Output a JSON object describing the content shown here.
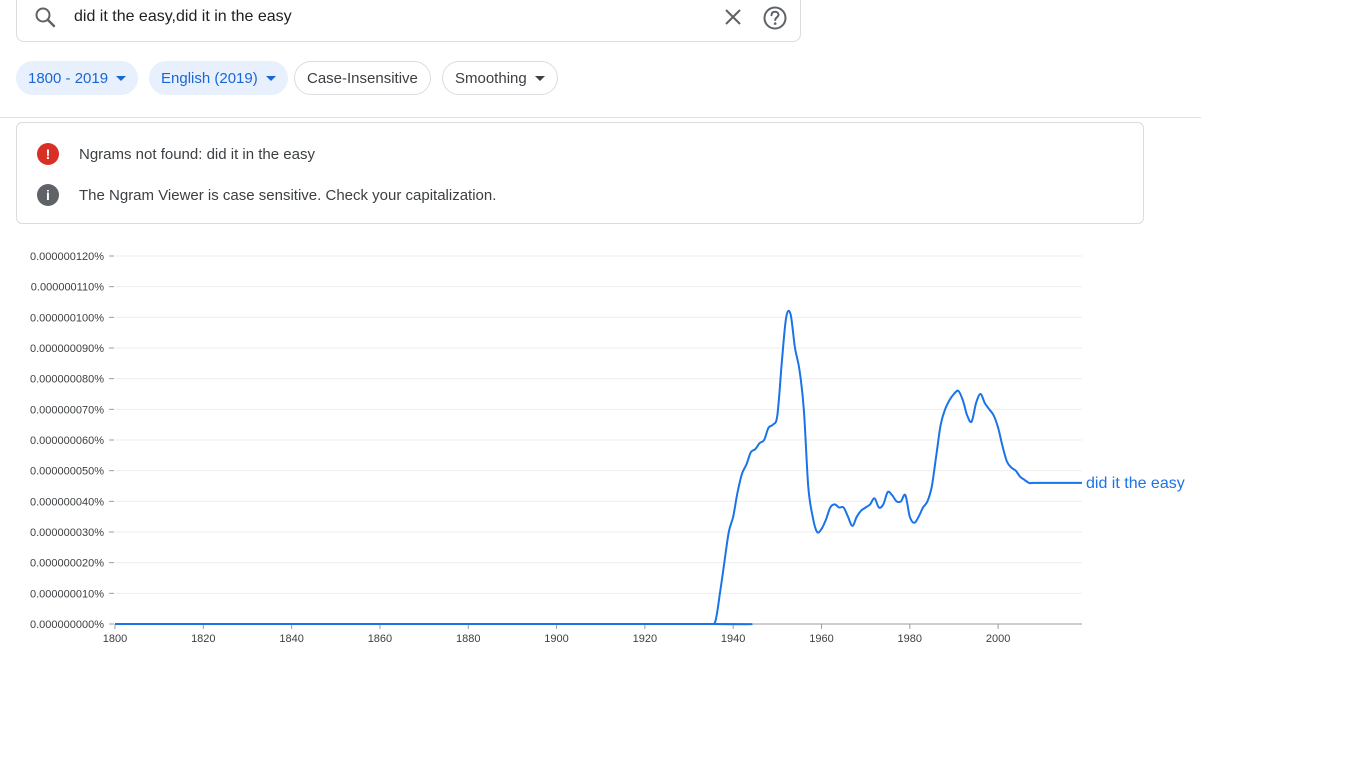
{
  "search": {
    "query": "did it the easy,did it in the easy"
  },
  "filters": {
    "year_range": "1800 - 2019",
    "corpus": "English (2019)",
    "case": "Case-Insensitive",
    "smoothing": "Smoothing"
  },
  "notices": [
    {
      "text": "Ngrams not found: did it in the easy",
      "icon_symbol": "!",
      "color": "#d93025"
    },
    {
      "text": "The Ngram Viewer is case sensitive. Check your capitalization.",
      "icon_symbol": "i",
      "color": "#5f6368"
    }
  ],
  "chart_data": {
    "type": "line",
    "title": "",
    "xlabel": "",
    "ylabel": "",
    "xlim": [
      1800,
      2019
    ],
    "ylim": [
      0,
      1.2e-07
    ],
    "y_tick_labels": [
      "0.000000000%",
      "0.000000010%",
      "0.000000020%",
      "0.000000030%",
      "0.000000040%",
      "0.000000050%",
      "0.000000060%",
      "0.000000070%",
      "0.000000080%",
      "0.000000090%",
      "0.000000100%",
      "0.000000110%",
      "0.000000120%"
    ],
    "x_tick_labels": [
      "1800",
      "1820",
      "1840",
      "1860",
      "1880",
      "1900",
      "1920",
      "1940",
      "1960",
      "1980",
      "2000"
    ],
    "series": [
      {
        "name": "did it the easy",
        "color": "#1a73e8",
        "x": [
          1800,
          1934,
          1935,
          1936,
          1937,
          1938,
          1939,
          1940,
          1941,
          1942,
          1943,
          1944,
          1945,
          1946,
          1947,
          1948,
          1949,
          1950,
          1951,
          1952,
          1953,
          1954,
          1955,
          1956,
          1957,
          1958,
          1959,
          1960,
          1961,
          1962,
          1963,
          1964,
          1965,
          1966,
          1967,
          1968,
          1969,
          1970,
          1971,
          1972,
          1973,
          1974,
          1975,
          1976,
          1977,
          1978,
          1979,
          1980,
          1981,
          1982,
          1983,
          1984,
          1985,
          1986,
          1987,
          1988,
          1989,
          1990,
          1991,
          1992,
          1993,
          1994,
          1995,
          1996,
          1997,
          1998,
          1999,
          2000,
          2001,
          2002,
          2003,
          2004,
          2005,
          2006,
          2007,
          2008,
          2009,
          2010,
          2011,
          2012,
          2013,
          2014,
          2015,
          2016,
          2017,
          2018,
          2019
        ],
        "values": [
          0,
          0,
          0,
          0.1,
          1.0,
          2.0,
          3.0,
          3.5,
          4.3,
          4.9,
          5.2,
          5.6,
          5.7,
          5.9,
          6.0,
          6.4,
          6.5,
          6.8,
          8.5,
          10.0,
          10.1,
          9.0,
          8.3,
          7.0,
          4.5,
          3.5,
          3.0,
          3.1,
          3.4,
          3.8,
          3.9,
          3.8,
          3.8,
          3.5,
          3.2,
          3.5,
          3.7,
          3.8,
          3.9,
          4.1,
          3.8,
          3.9,
          4.3,
          4.2,
          4.0,
          4.0,
          4.2,
          3.5,
          3.3,
          3.5,
          3.8,
          4.0,
          4.5,
          5.5,
          6.5,
          7.0,
          7.3,
          7.5,
          7.6,
          7.3,
          6.8,
          6.6,
          7.2,
          7.5,
          7.2,
          7.0,
          6.8,
          6.4,
          5.8,
          5.3,
          5.1,
          5.0,
          4.8,
          4.7,
          4.6,
          4.6,
          4.6,
          4.6,
          4.6,
          4.6,
          4.6,
          4.6,
          4.6,
          4.6,
          4.6,
          4.6,
          4.6
        ],
        "value_unit": "1e-8 %"
      }
    ],
    "grid": true,
    "legend": "inline-right"
  }
}
